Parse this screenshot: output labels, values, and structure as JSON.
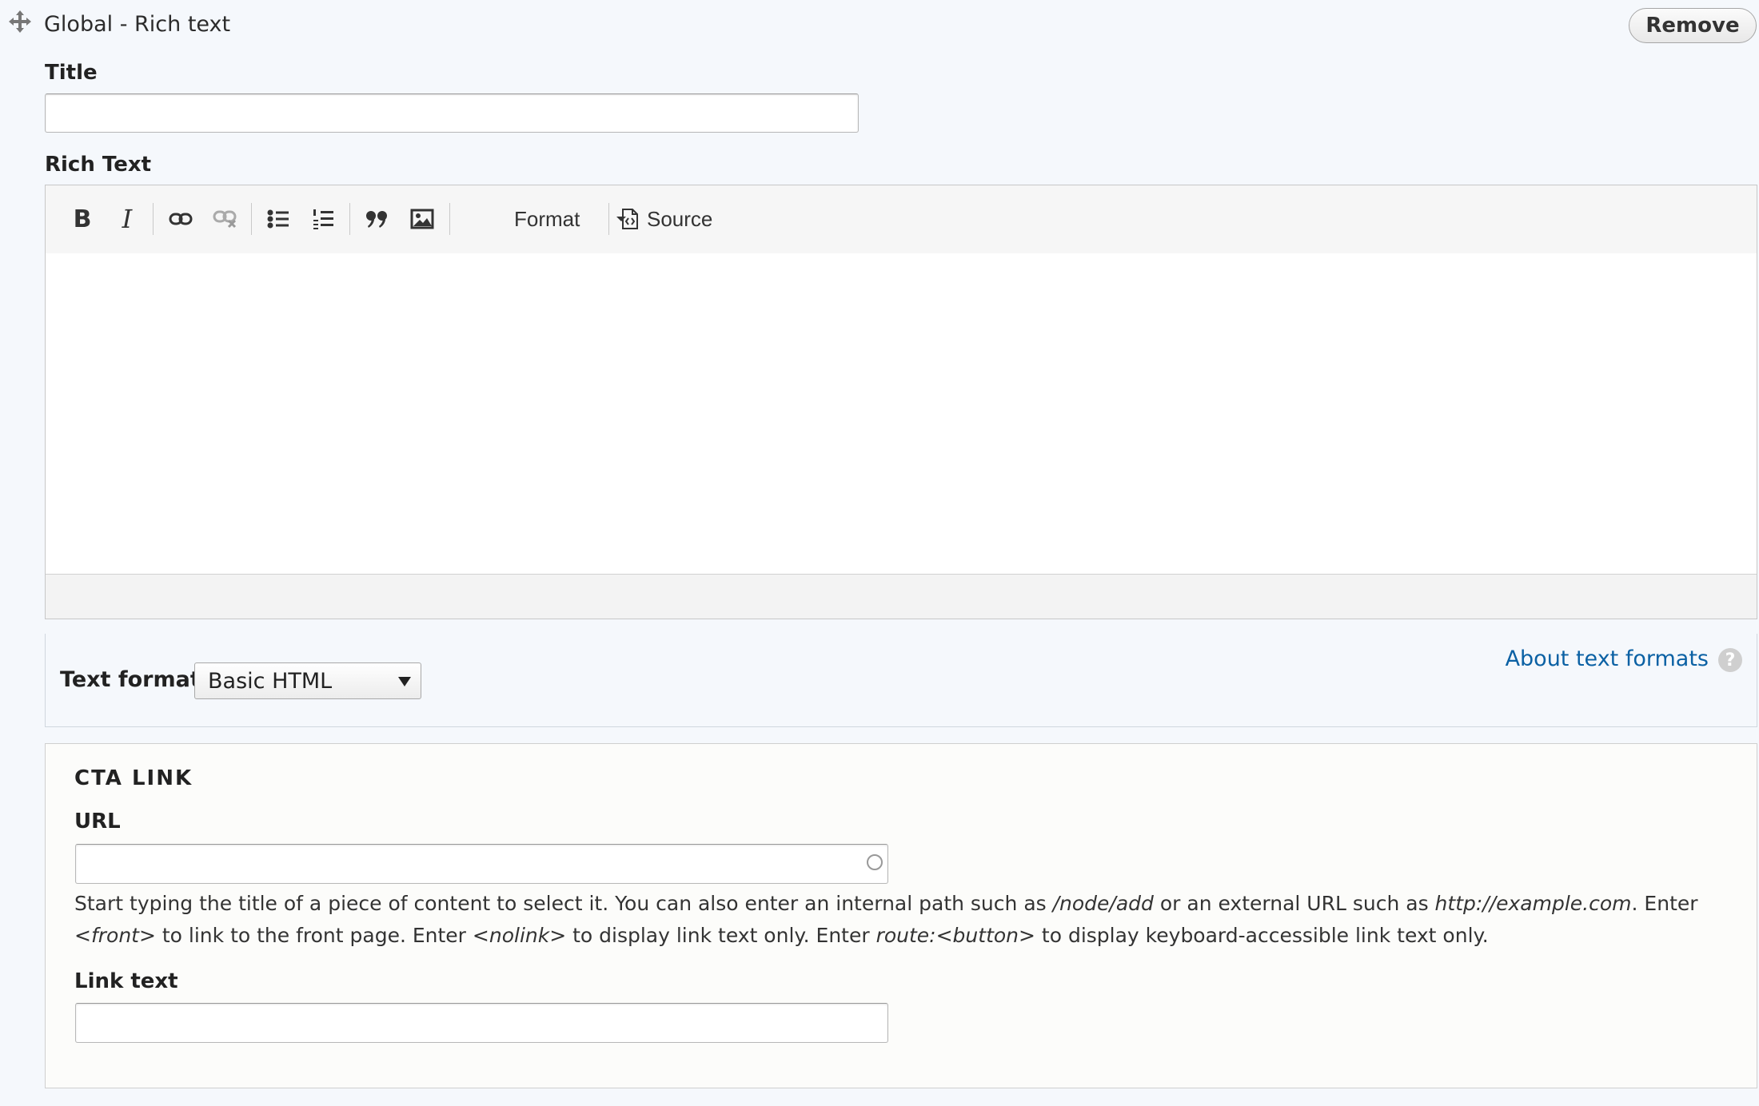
{
  "header": {
    "paragraph_type": "Global - Rich text",
    "remove_label": "Remove"
  },
  "title_field": {
    "label": "Title",
    "value": ""
  },
  "rich_text": {
    "label": "Rich Text",
    "toolbar": {
      "bold": "B",
      "italic": "I",
      "format_label": "Format",
      "source_label": "Source"
    },
    "content": ""
  },
  "text_format": {
    "label": "Text format",
    "selected": "Basic HTML",
    "about_link": "About text formats",
    "help_glyph": "?"
  },
  "cta_link": {
    "legend": "CTA LINK",
    "url": {
      "label": "URL",
      "value": "",
      "description": {
        "p1": "Start typing the title of a piece of content to select it. You can also enter an internal path such as ",
        "em1": "/node/add",
        "p2": " or an external URL such as ",
        "em2": "http://example.com",
        "p3": ". Enter ",
        "em3": "<front>",
        "p4": " to link to the front page. Enter ",
        "em4": "<nolink>",
        "p5": " to display link text only. Enter ",
        "em5": "route:<button>",
        "p6": " to display keyboard-accessible link text only."
      }
    },
    "link_text": {
      "label": "Link text",
      "value": ""
    }
  }
}
